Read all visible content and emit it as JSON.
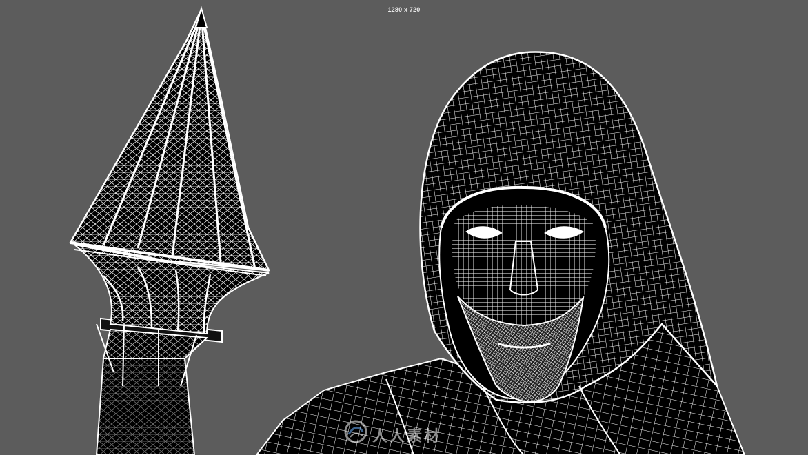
{
  "viewport": {
    "resolution_label": "1280 x 720",
    "background_color": "#5c5c5c",
    "wire_color": "#ffffff",
    "mesh_fill_color": "#000000"
  },
  "scene": {
    "objects": [
      "staff-mesh",
      "hooded-figure-mesh"
    ]
  },
  "watermark": {
    "text": "人人素材",
    "logo_icon": "swirl-logo-icon"
  }
}
